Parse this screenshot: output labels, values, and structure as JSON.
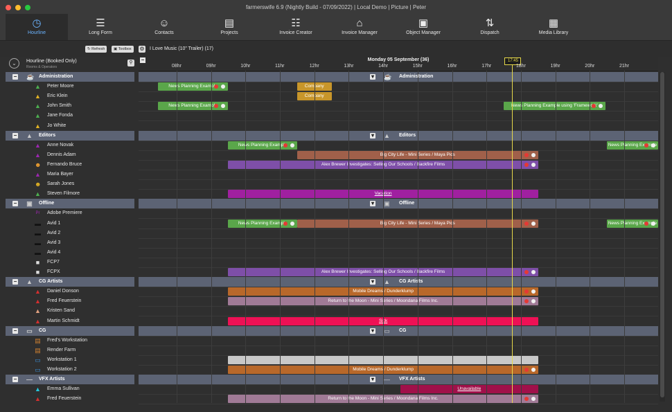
{
  "window": {
    "title": "farmerswife 6.9  (Nightly Build - 07/09/2022) | Local Demo | Picture | Peter"
  },
  "toolbar": {
    "items": [
      {
        "label": "Hourline",
        "icon": "clock-icon"
      },
      {
        "label": "Long Form",
        "icon": "timeline-icon"
      },
      {
        "label": "Contacts",
        "icon": "contacts-icon"
      },
      {
        "label": "Projects",
        "icon": "briefcase-icon"
      },
      {
        "label": "Invoice Creator",
        "icon": "invoice-icon"
      },
      {
        "label": "Invoice Manager",
        "icon": "bank-icon"
      },
      {
        "label": "Object Manager",
        "icon": "objects-icon"
      },
      {
        "label": "Dispatch",
        "icon": "dispatch-icon"
      },
      {
        "label": "Media Library",
        "icon": "media-icon"
      }
    ]
  },
  "subbar": {
    "refresh": "Refresh",
    "toolbox": "Toolbox",
    "project": "I Love Music (10\" Trailer) (17)"
  },
  "panel": {
    "title": "Hourline (Booked Only)",
    "subtitle": "Rooms & Operators"
  },
  "timeline": {
    "date": "Monday 05 September (36)",
    "now": "17:45",
    "hours": [
      "08hr",
      "09hr",
      "10hr",
      "11hr",
      "12hr",
      "13hr",
      "14hr",
      "15hr",
      "16hr",
      "17hr",
      "18hr",
      "19hr",
      "20hr",
      "21hr"
    ]
  },
  "rows": [
    {
      "type": "group",
      "label": "Administration",
      "icon": "admin-icon"
    },
    {
      "type": "res",
      "label": "Peter Moore",
      "icon": "person-icon",
      "color": "#4caf50"
    },
    {
      "type": "res",
      "label": "Eric Klein",
      "icon": "person-icon",
      "color": "#e3b324"
    },
    {
      "type": "res",
      "label": "John Smith",
      "icon": "person-icon",
      "color": "#4caf50"
    },
    {
      "type": "res",
      "label": "Jane Fonda",
      "icon": "person-icon",
      "color": "#4caf50"
    },
    {
      "type": "res",
      "label": "Jo White",
      "icon": "person-icon",
      "color": "#e3b324"
    },
    {
      "type": "group",
      "label": "Editors",
      "icon": "editor-icon"
    },
    {
      "type": "res",
      "label": "Anne Novak",
      "icon": "person-icon",
      "color": "#9c27b0"
    },
    {
      "type": "res",
      "label": "Dennis Adam",
      "icon": "person-icon",
      "color": "#9c27b0"
    },
    {
      "type": "res",
      "label": "Fernando Bruce",
      "icon": "face-icon",
      "color": "#f0a030"
    },
    {
      "type": "res",
      "label": "Maria Bayer",
      "icon": "person-icon",
      "color": "#9c27b0"
    },
    {
      "type": "res",
      "label": "Sarah Jones",
      "icon": "face-icon",
      "color": "#e3b324"
    },
    {
      "type": "res",
      "label": "Steven Filmore",
      "icon": "person-icon",
      "color": "#4caf50"
    },
    {
      "type": "group",
      "label": "Offline",
      "icon": "offline-icon"
    },
    {
      "type": "res",
      "label": "Adobe Premiere",
      "icon": "premiere-icon",
      "color": "#9c27b0"
    },
    {
      "type": "res",
      "label": "Avid 1",
      "icon": "avid-icon",
      "color": "#111"
    },
    {
      "type": "res",
      "label": "Avid 2",
      "icon": "avid-icon",
      "color": "#111"
    },
    {
      "type": "res",
      "label": "Avid 3",
      "icon": "avid-icon",
      "color": "#111"
    },
    {
      "type": "res",
      "label": "Avid 4",
      "icon": "avid-icon",
      "color": "#111"
    },
    {
      "type": "res",
      "label": "FCP7",
      "icon": "fcp-icon",
      "color": "#ddd"
    },
    {
      "type": "res",
      "label": "FCPX",
      "icon": "fcp-icon",
      "color": "#ddd"
    },
    {
      "type": "group",
      "label": "CG Artists",
      "icon": "cg-artist-icon"
    },
    {
      "type": "res",
      "label": "Daniel Donson",
      "icon": "person-icon",
      "color": "#d32f2f"
    },
    {
      "type": "res",
      "label": "Fred Feuerstein",
      "icon": "person-icon",
      "color": "#d32f2f"
    },
    {
      "type": "res",
      "label": "Kristen Sand",
      "icon": "person-icon",
      "color": "#e0a080"
    },
    {
      "type": "res",
      "label": "Martin Schmidt",
      "icon": "person-icon",
      "color": "#d32f2f"
    },
    {
      "type": "group",
      "label": "CG",
      "icon": "monitor-icon"
    },
    {
      "type": "res",
      "label": "Fred's Workstation",
      "icon": "workstation-icon",
      "color": "#d08030"
    },
    {
      "type": "res",
      "label": "Render Farm",
      "icon": "workstation-icon",
      "color": "#d08030"
    },
    {
      "type": "res",
      "label": "Workstation 1",
      "icon": "monitor-icon",
      "color": "#3b8fd9"
    },
    {
      "type": "res",
      "label": "Workstation 2",
      "icon": "monitor-icon",
      "color": "#3b8fd9"
    },
    {
      "type": "group",
      "label": "VFX Artists",
      "icon": "vfx-icon"
    },
    {
      "type": "res",
      "label": "Emma Sullivan",
      "icon": "person-icon",
      "color": "#26c6da"
    },
    {
      "type": "res",
      "label": "Fred Feuerstein",
      "icon": "person-icon",
      "color": "#d32f2f"
    }
  ],
  "bookings": [
    {
      "row": 1,
      "start": -0.05,
      "end": 2.0,
      "label": "News Planning Example",
      "color": "#5aa64a",
      "dots": true
    },
    {
      "row": 1,
      "start": 4.0,
      "end": 5.0,
      "label": "Company",
      "color": "#c8962a",
      "dots": false
    },
    {
      "row": 2,
      "start": 4.0,
      "end": 5.0,
      "label": "Company",
      "color": "#c8962a",
      "dots": false
    },
    {
      "row": 3,
      "start": -0.05,
      "end": 2.0,
      "label": "News Planning Example",
      "color": "#5aa64a",
      "dots": true
    },
    {
      "row": 3,
      "start": 10.0,
      "end": 12.95,
      "label": "News Planning Example using 'Framework'",
      "color": "#5aa64a",
      "dots": true
    },
    {
      "row": 7,
      "start": 2.0,
      "end": 4.0,
      "label": "News Planning Example",
      "color": "#5aa64a",
      "dots": true
    },
    {
      "row": 7,
      "start": 13.0,
      "end": 15.0,
      "label": "News Planning Example",
      "color": "#5aa64a",
      "dots": true
    },
    {
      "row": 8,
      "start": 4.0,
      "end": 11.0,
      "label": "Big City Life - Mini Series / Maya Pics",
      "color": "#a0604a",
      "dots": true
    },
    {
      "row": 9,
      "start": 2.0,
      "end": 11.0,
      "label": "Alex Brewer Investigates: Selling Our Schools / Backfire Films",
      "color": "#7e4fa8",
      "dots": true
    },
    {
      "row": 12,
      "start": 2.0,
      "end": 11.0,
      "label": "Vacation",
      "color": "#a020a0",
      "dots": false
    },
    {
      "row": 15,
      "start": 2.0,
      "end": 4.0,
      "label": "News Planning Example",
      "color": "#5aa64a",
      "dots": true
    },
    {
      "row": 15,
      "start": 4.0,
      "end": 11.0,
      "label": "Big City Life - Mini Series / Maya Pics",
      "color": "#a0604a",
      "dots": true
    },
    {
      "row": 15,
      "start": 13.0,
      "end": 15.0,
      "label": "News Planning Example",
      "color": "#5aa64a",
      "dots": true
    },
    {
      "row": 20,
      "start": 2.0,
      "end": 11.0,
      "label": "Alex Brewer Investigates: Selling Our Schools / Backfire Films",
      "color": "#7e4fa8",
      "dots": true
    },
    {
      "row": 22,
      "start": 2.0,
      "end": 11.0,
      "label": "Mobile Dreams / Dunderklump",
      "color": "#b8682a",
      "dots": true
    },
    {
      "row": 23,
      "start": 2.0,
      "end": 11.0,
      "label": "Return to the Moon - Mini Series / Moondana Films Inc.",
      "color": "#a07a96",
      "dots": true
    },
    {
      "row": 25,
      "start": 2.0,
      "end": 11.0,
      "label": "Sick",
      "color": "#ee1155",
      "dots": false
    },
    {
      "row": 29,
      "start": 2.0,
      "end": 11.0,
      "label": "",
      "color": "#c8c8c8",
      "dots": false
    },
    {
      "row": 30,
      "start": 2.0,
      "end": 11.0,
      "label": "Mobile Dreams / Dunderklump",
      "color": "#b8682a",
      "dots": true
    },
    {
      "row": 32,
      "start": 7.0,
      "end": 11.0,
      "label": "Unavailable",
      "color": "#a0104a",
      "dots": false
    },
    {
      "row": 33,
      "start": 2.0,
      "end": 11.0,
      "label": "Return to the Moon - Mini Series / Moondana Films Inc.",
      "color": "#a07a96",
      "dots": true
    }
  ]
}
